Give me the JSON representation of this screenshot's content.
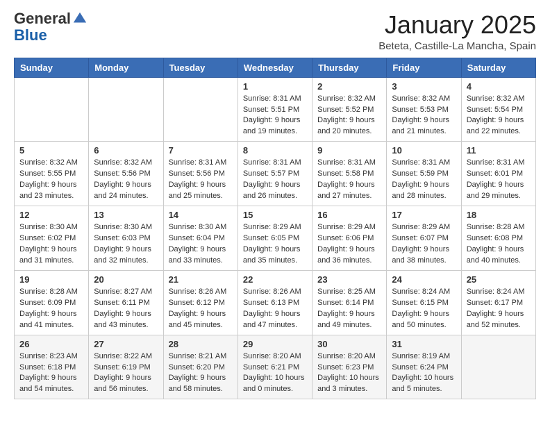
{
  "logo": {
    "general": "General",
    "blue": "Blue"
  },
  "header": {
    "month": "January 2025",
    "location": "Beteta, Castille-La Mancha, Spain"
  },
  "weekdays": [
    "Sunday",
    "Monday",
    "Tuesday",
    "Wednesday",
    "Thursday",
    "Friday",
    "Saturday"
  ],
  "weeks": [
    [
      {
        "day": "",
        "info": ""
      },
      {
        "day": "",
        "info": ""
      },
      {
        "day": "",
        "info": ""
      },
      {
        "day": "1",
        "info": "Sunrise: 8:31 AM\nSunset: 5:51 PM\nDaylight: 9 hours\nand 19 minutes."
      },
      {
        "day": "2",
        "info": "Sunrise: 8:32 AM\nSunset: 5:52 PM\nDaylight: 9 hours\nand 20 minutes."
      },
      {
        "day": "3",
        "info": "Sunrise: 8:32 AM\nSunset: 5:53 PM\nDaylight: 9 hours\nand 21 minutes."
      },
      {
        "day": "4",
        "info": "Sunrise: 8:32 AM\nSunset: 5:54 PM\nDaylight: 9 hours\nand 22 minutes."
      }
    ],
    [
      {
        "day": "5",
        "info": "Sunrise: 8:32 AM\nSunset: 5:55 PM\nDaylight: 9 hours\nand 23 minutes."
      },
      {
        "day": "6",
        "info": "Sunrise: 8:32 AM\nSunset: 5:56 PM\nDaylight: 9 hours\nand 24 minutes."
      },
      {
        "day": "7",
        "info": "Sunrise: 8:31 AM\nSunset: 5:56 PM\nDaylight: 9 hours\nand 25 minutes."
      },
      {
        "day": "8",
        "info": "Sunrise: 8:31 AM\nSunset: 5:57 PM\nDaylight: 9 hours\nand 26 minutes."
      },
      {
        "day": "9",
        "info": "Sunrise: 8:31 AM\nSunset: 5:58 PM\nDaylight: 9 hours\nand 27 minutes."
      },
      {
        "day": "10",
        "info": "Sunrise: 8:31 AM\nSunset: 5:59 PM\nDaylight: 9 hours\nand 28 minutes."
      },
      {
        "day": "11",
        "info": "Sunrise: 8:31 AM\nSunset: 6:01 PM\nDaylight: 9 hours\nand 29 minutes."
      }
    ],
    [
      {
        "day": "12",
        "info": "Sunrise: 8:30 AM\nSunset: 6:02 PM\nDaylight: 9 hours\nand 31 minutes."
      },
      {
        "day": "13",
        "info": "Sunrise: 8:30 AM\nSunset: 6:03 PM\nDaylight: 9 hours\nand 32 minutes."
      },
      {
        "day": "14",
        "info": "Sunrise: 8:30 AM\nSunset: 6:04 PM\nDaylight: 9 hours\nand 33 minutes."
      },
      {
        "day": "15",
        "info": "Sunrise: 8:29 AM\nSunset: 6:05 PM\nDaylight: 9 hours\nand 35 minutes."
      },
      {
        "day": "16",
        "info": "Sunrise: 8:29 AM\nSunset: 6:06 PM\nDaylight: 9 hours\nand 36 minutes."
      },
      {
        "day": "17",
        "info": "Sunrise: 8:29 AM\nSunset: 6:07 PM\nDaylight: 9 hours\nand 38 minutes."
      },
      {
        "day": "18",
        "info": "Sunrise: 8:28 AM\nSunset: 6:08 PM\nDaylight: 9 hours\nand 40 minutes."
      }
    ],
    [
      {
        "day": "19",
        "info": "Sunrise: 8:28 AM\nSunset: 6:09 PM\nDaylight: 9 hours\nand 41 minutes."
      },
      {
        "day": "20",
        "info": "Sunrise: 8:27 AM\nSunset: 6:11 PM\nDaylight: 9 hours\nand 43 minutes."
      },
      {
        "day": "21",
        "info": "Sunrise: 8:26 AM\nSunset: 6:12 PM\nDaylight: 9 hours\nand 45 minutes."
      },
      {
        "day": "22",
        "info": "Sunrise: 8:26 AM\nSunset: 6:13 PM\nDaylight: 9 hours\nand 47 minutes."
      },
      {
        "day": "23",
        "info": "Sunrise: 8:25 AM\nSunset: 6:14 PM\nDaylight: 9 hours\nand 49 minutes."
      },
      {
        "day": "24",
        "info": "Sunrise: 8:24 AM\nSunset: 6:15 PM\nDaylight: 9 hours\nand 50 minutes."
      },
      {
        "day": "25",
        "info": "Sunrise: 8:24 AM\nSunset: 6:17 PM\nDaylight: 9 hours\nand 52 minutes."
      }
    ],
    [
      {
        "day": "26",
        "info": "Sunrise: 8:23 AM\nSunset: 6:18 PM\nDaylight: 9 hours\nand 54 minutes."
      },
      {
        "day": "27",
        "info": "Sunrise: 8:22 AM\nSunset: 6:19 PM\nDaylight: 9 hours\nand 56 minutes."
      },
      {
        "day": "28",
        "info": "Sunrise: 8:21 AM\nSunset: 6:20 PM\nDaylight: 9 hours\nand 58 minutes."
      },
      {
        "day": "29",
        "info": "Sunrise: 8:20 AM\nSunset: 6:21 PM\nDaylight: 10 hours\nand 0 minutes."
      },
      {
        "day": "30",
        "info": "Sunrise: 8:20 AM\nSunset: 6:23 PM\nDaylight: 10 hours\nand 3 minutes."
      },
      {
        "day": "31",
        "info": "Sunrise: 8:19 AM\nSunset: 6:24 PM\nDaylight: 10 hours\nand 5 minutes."
      },
      {
        "day": "",
        "info": ""
      }
    ]
  ]
}
